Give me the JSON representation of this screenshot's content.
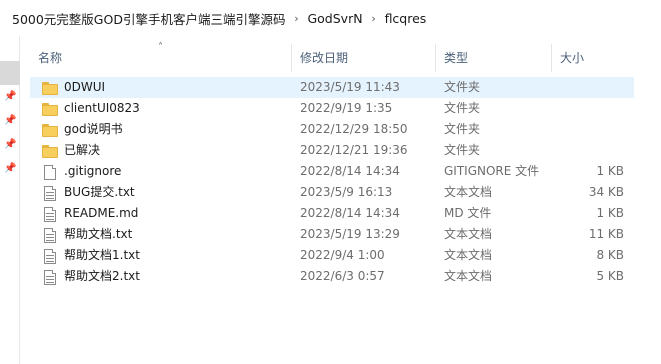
{
  "breadcrumb": {
    "items": [
      "5000元完整版GOD引擎手机客户端三端引擎源码",
      "GodSvrN",
      "flcqres"
    ],
    "separator": "›"
  },
  "columns": {
    "name": "名称",
    "date": "修改日期",
    "type": "类型",
    "size": "大小"
  },
  "files": [
    {
      "name": "0DWUI",
      "date": "2023/5/19 11:43",
      "type": "文件夹",
      "size": "",
      "kind": "folder",
      "selected": true
    },
    {
      "name": "clientUI0823",
      "date": "2022/9/19 1:35",
      "type": "文件夹",
      "size": "",
      "kind": "folder"
    },
    {
      "name": "god说明书",
      "date": "2022/12/29 18:50",
      "type": "文件夹",
      "size": "",
      "kind": "folder"
    },
    {
      "name": "已解决",
      "date": "2022/12/21 19:36",
      "type": "文件夹",
      "size": "",
      "kind": "folder"
    },
    {
      "name": ".gitignore",
      "date": "2022/8/14 14:34",
      "type": "GITIGNORE 文件",
      "size": "1 KB",
      "kind": "file"
    },
    {
      "name": "BUG提交.txt",
      "date": "2023/5/9 16:13",
      "type": "文本文档",
      "size": "34 KB",
      "kind": "text"
    },
    {
      "name": "README.md",
      "date": "2022/8/14 14:34",
      "type": "MD 文件",
      "size": "1 KB",
      "kind": "text"
    },
    {
      "name": "帮助文档.txt",
      "date": "2023/5/19 13:29",
      "type": "文本文档",
      "size": "11 KB",
      "kind": "text"
    },
    {
      "name": "帮助文档1.txt",
      "date": "2022/9/4 1:00",
      "type": "文本文档",
      "size": "8 KB",
      "kind": "text"
    },
    {
      "name": "帮助文档2.txt",
      "date": "2022/6/3 0:57",
      "type": "文本文档",
      "size": "5 KB",
      "kind": "text"
    }
  ],
  "icons": {
    "folder": "folder-icon",
    "file": "file-icon",
    "text": "text-document-icon",
    "pin": "pin-icon",
    "sort": "sort-ascending-icon"
  },
  "colors": {
    "selected_row": "#e5f3ff",
    "header_text": "#4c607a",
    "folder": "#f8cf5c"
  }
}
